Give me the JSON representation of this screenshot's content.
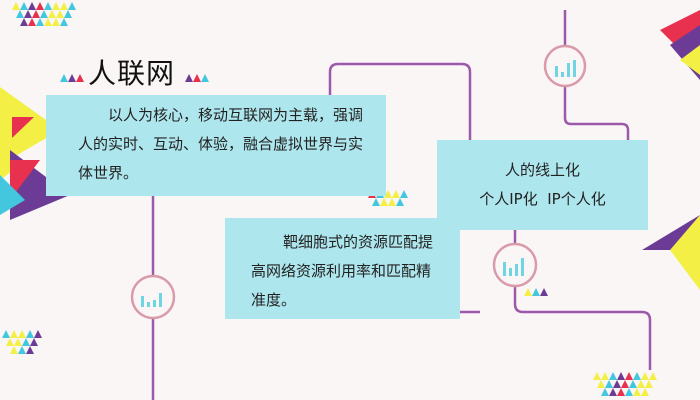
{
  "title": "人联网",
  "box1": {
    "text": "以人为核心，移动互联网为主载，强调人的实时、互动、体验，融合虚拟世界与实体世界。"
  },
  "box2": {
    "line1": "人的线上化",
    "line2": "个人IP化  IP个人化"
  },
  "box3": {
    "text": "靶细胞式的资源匹配提高网络资源利用率和匹配精准度。"
  },
  "colors": {
    "background": "#fbf6f6",
    "box": "#aee6ee",
    "line": "#9b59a9",
    "circle": "#d99aaa",
    "bars": "#6fd4e4",
    "yellow": "#f3ef45",
    "red": "#e8314f",
    "purple": "#6c3b96",
    "cyan": "#43c7df"
  }
}
